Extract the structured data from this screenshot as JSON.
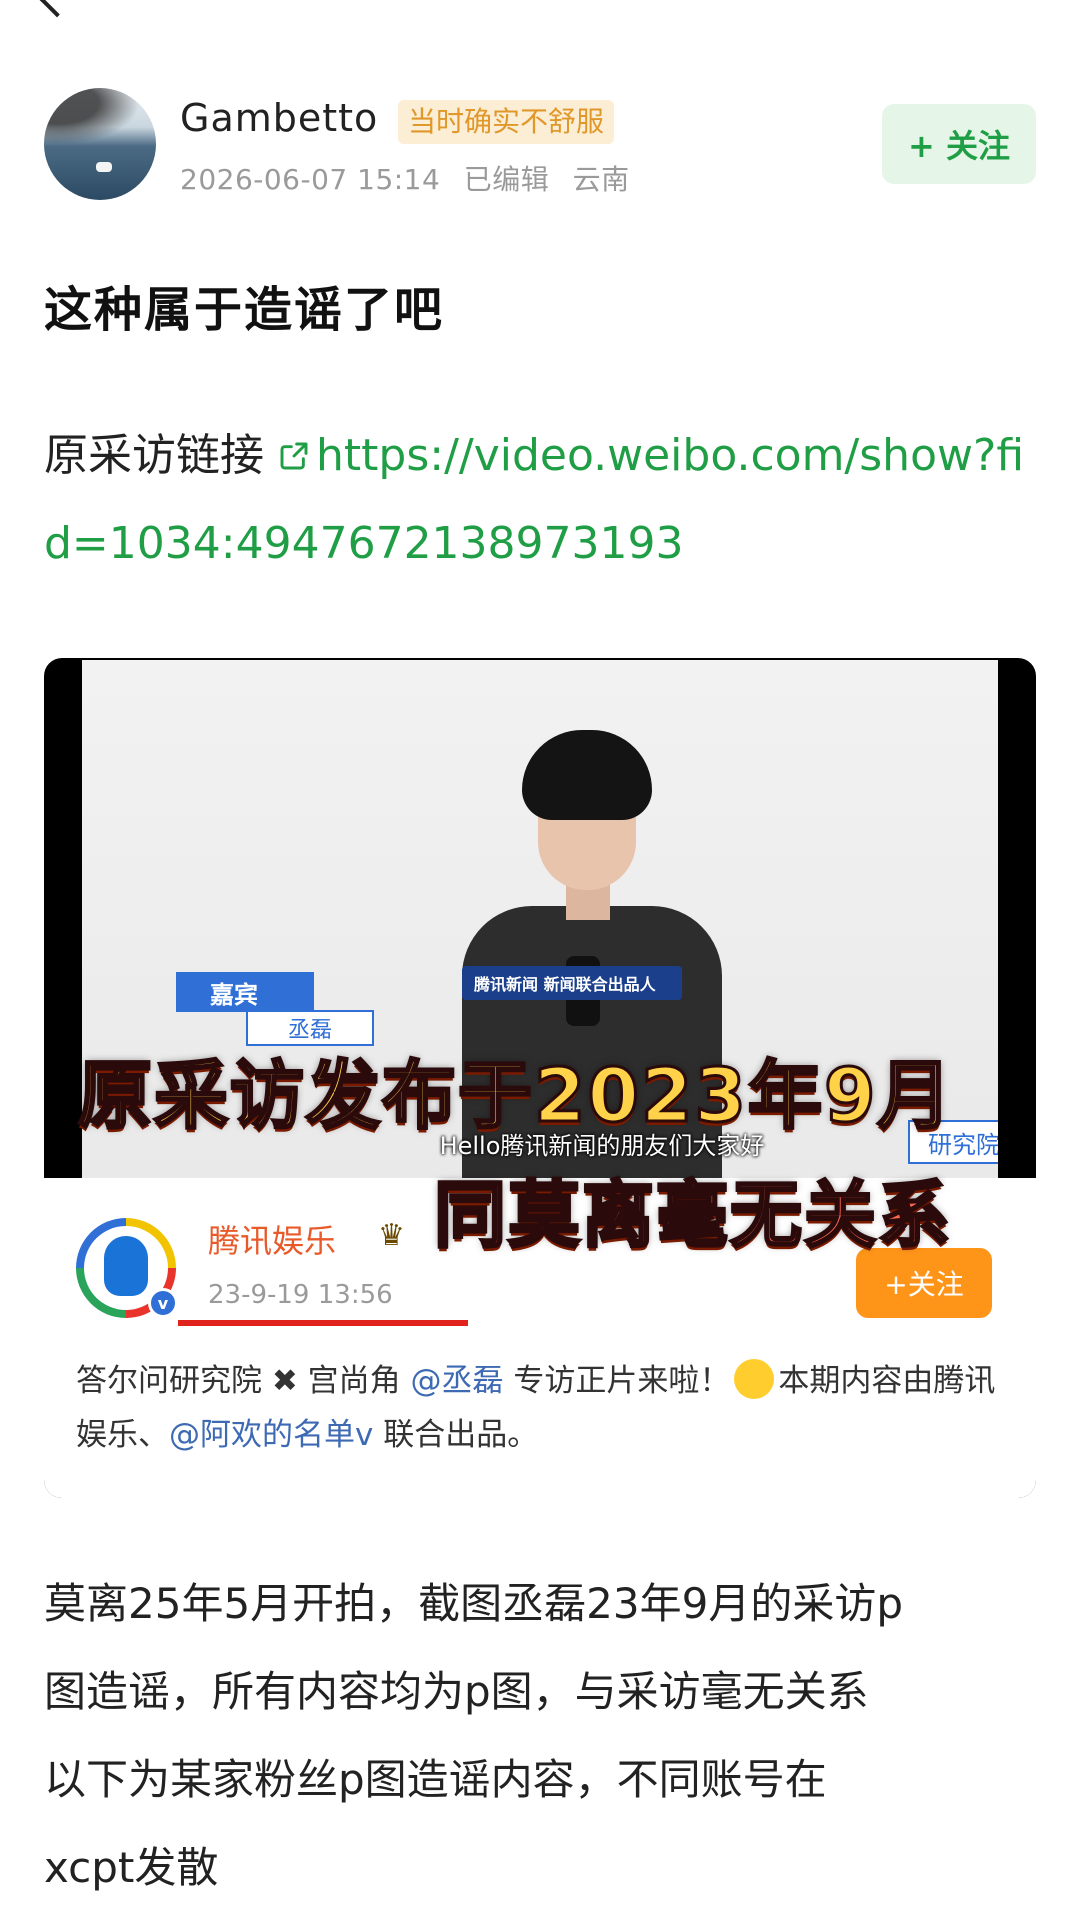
{
  "header": {
    "username": "Gambetto",
    "user_tag": "当时确实不舒服",
    "timestamp": "2026-06-07 15:14",
    "edited": "已编辑",
    "location": "云南",
    "follow_label": "+ 关注"
  },
  "post": {
    "title": "这种属于造谣了吧",
    "link_label": "原采访链接",
    "link_url": "https://video.weibo.com/show?fid=1034:4947672138973193",
    "body_lines": [
      "莫离25年5月开拍，截图丞磊23年9月的采访p",
      "图造谣，所有内容均为p图，与采访毫无关系",
      "以下为某家粉丝p图造谣内容，不同账号在",
      "xcpt发散"
    ]
  },
  "image": {
    "guest_tag": "嘉宾",
    "guest_name": "丞磊",
    "institute_tag": "研究院",
    "mic_tag": "腾讯新闻 新闻联合出品人",
    "subtitle": "Hello腾讯新闻的朋友们大家好",
    "overlay_line1": "原采访发布于2023年9月",
    "overlay_line2": "同莫离毫无关系",
    "card": {
      "name": "腾讯娱乐",
      "time": "23-9-19 13:56",
      "follow_label": "+关注",
      "text_part1": "答尔问研究院 ✖ 宫尚角 ",
      "mention1": "@丞磊",
      "text_part2": " 专访正片来啦！",
      "text_part3": "本期内容由腾讯娱乐、",
      "mention2": "@阿欢的名单v",
      "text_part4": " 联合出品。"
    }
  },
  "colors": {
    "accent_green": "#1f9e45",
    "tag_orange": "#e0982a",
    "overlay_yellow": "#ffd24a",
    "overlay_red": "#ff6a4f",
    "underline_red": "#e0231c"
  }
}
